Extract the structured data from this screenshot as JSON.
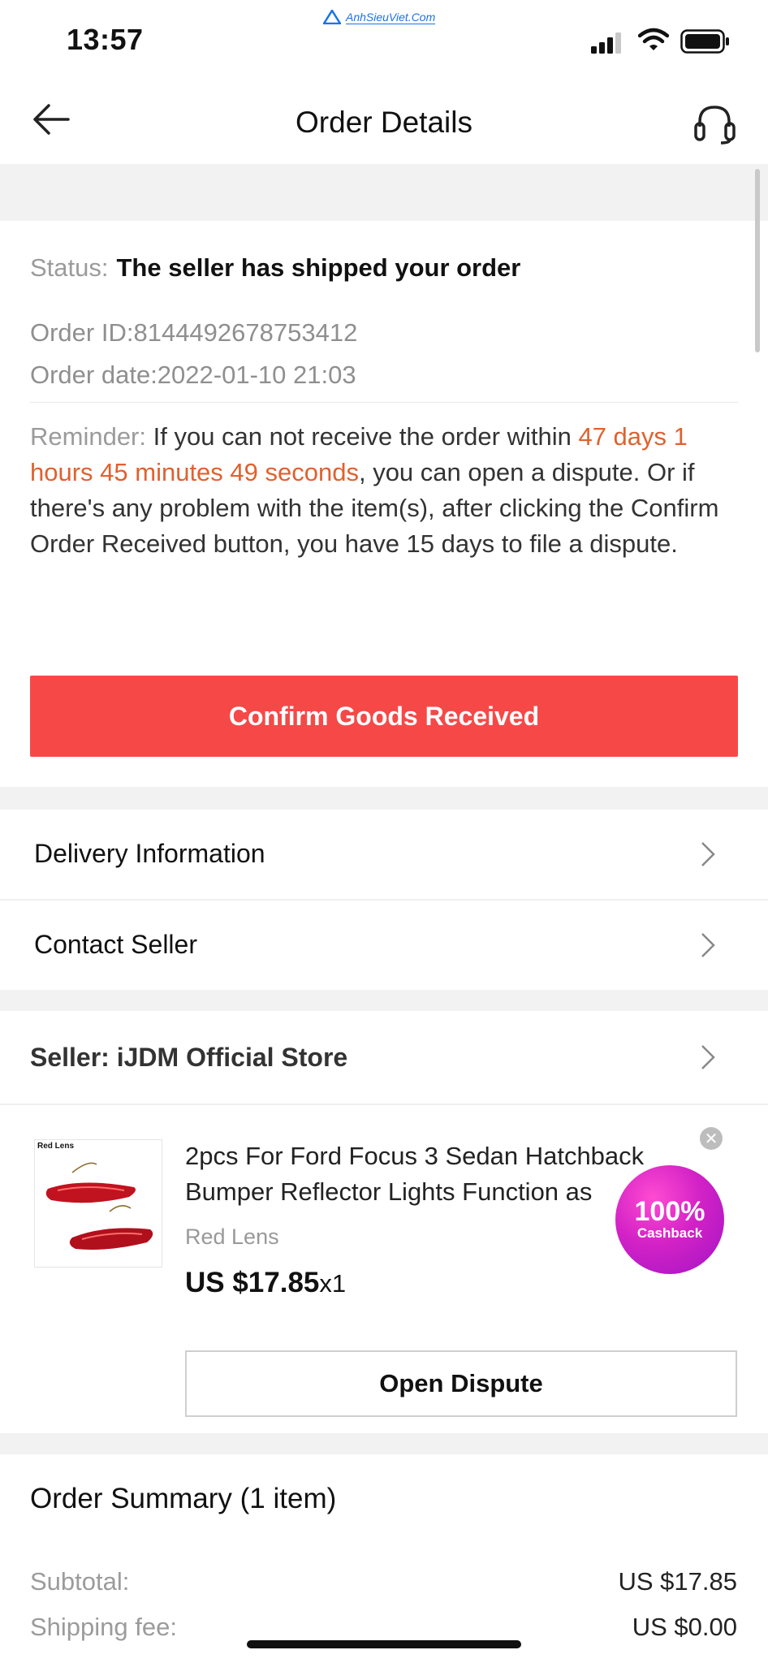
{
  "status_bar": {
    "time": "13:57",
    "watermark": "AnhSieuViet.Com"
  },
  "header": {
    "title": "Order Details",
    "back_icon": "arrow-left-icon",
    "support_icon": "headset-icon"
  },
  "order": {
    "status_label": "Status:",
    "status_value": "The seller has shipped your order",
    "order_id": "Order ID:8144492678753412",
    "order_date": "Order date:2022-01-10 21:03",
    "reminder_label": "Reminder:",
    "reminder_part1": " If you can not receive the order within ",
    "reminder_highlight": "47 days 1 hours 45 minutes 49 seconds",
    "reminder_part2": ", you can open a dispute. Or if there's any problem with the item(s), after clicking the Confirm Order Received button, you have 15 days to file a dispute.",
    "confirm_button": "Confirm Goods Received"
  },
  "links": {
    "delivery": "Delivery Information",
    "contact": "Contact Seller"
  },
  "seller": {
    "label": "Seller: iJDM Official Store"
  },
  "product": {
    "image_label": "Red Lens",
    "title": "2pcs For Ford Focus 3 Sedan Hatchback Bumper Reflector Lights Function as",
    "variant": "Red Lens",
    "price": "US $17.85",
    "quantity": "x1",
    "dispute_button": "Open Dispute",
    "cashback_percent": "100%",
    "cashback_label": "Cashback"
  },
  "summary": {
    "title": "Order Summary (1 item)",
    "rows": [
      {
        "label": "Subtotal:",
        "value": "US $17.85"
      },
      {
        "label": "Shipping fee:",
        "value": "US $0.00"
      }
    ]
  },
  "colors": {
    "accent_red": "#f74848",
    "highlight_orange": "#e0612f",
    "cashback_purple": "#c21cc8"
  }
}
